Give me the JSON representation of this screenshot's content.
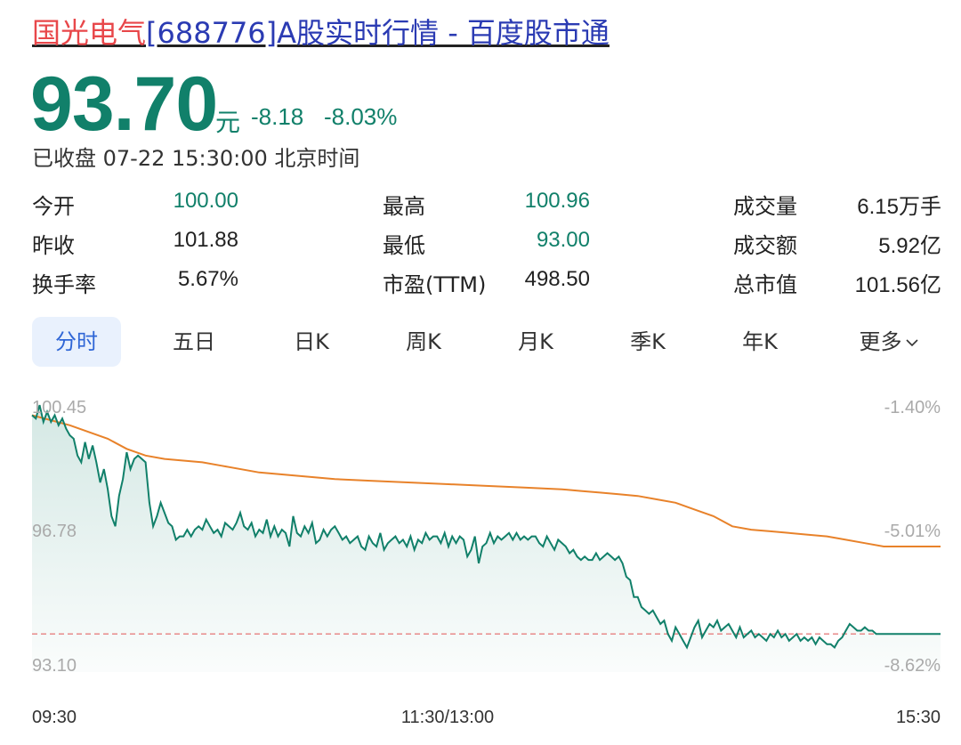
{
  "header": {
    "title_stock": "国光电气",
    "title_rest": "[688776]A股实时行情 - 百度股市通"
  },
  "quote": {
    "price": "93.70",
    "unit": "元",
    "change": "-8.18",
    "change_pct": "-8.03%",
    "status": "已收盘 07-22 15:30:00 北京时间"
  },
  "stats": [
    [
      {
        "label": "今开",
        "value": "100.00",
        "color": "green"
      },
      {
        "label": "最高",
        "value": "100.96",
        "color": "green"
      },
      {
        "label": "成交量",
        "value": "6.15万手",
        "color": "dark"
      }
    ],
    [
      {
        "label": "昨收",
        "value": "101.88",
        "color": "dark"
      },
      {
        "label": "最低",
        "value": "93.00",
        "color": "green"
      },
      {
        "label": "成交额",
        "value": "5.92亿",
        "color": "dark"
      }
    ],
    [
      {
        "label": "换手率",
        "value": "5.67%",
        "color": "dark"
      },
      {
        "label": "市盈(TTM)",
        "value": "498.50",
        "color": "dark"
      },
      {
        "label": "总市值",
        "value": "101.56亿",
        "color": "dark"
      }
    ]
  ],
  "tabs": [
    "分时",
    "五日",
    "日K",
    "周K",
    "月K",
    "季K",
    "年K",
    "更多"
  ],
  "colors": {
    "price_line": "#11806a",
    "avg_line": "#e8822a",
    "ref_line": "#e88a8a",
    "active_tab": "#2f66d6"
  },
  "chart_data": {
    "type": "line",
    "ylim": [
      93.1,
      100.45
    ],
    "y_ticks_left": [
      "100.45",
      "96.78",
      "93.10"
    ],
    "y_ticks_right": [
      "-1.40%",
      "-5.01%",
      "-8.62%"
    ],
    "x_ticks": [
      "09:30",
      "11:30/13:00",
      "15:30"
    ],
    "reference_line": 93.7,
    "series": [
      {
        "role": "price",
        "t": [
          0,
          1,
          2,
          3,
          4,
          5,
          6,
          7,
          8,
          9,
          10,
          11,
          12,
          13,
          14,
          15,
          16,
          17,
          18,
          19,
          20,
          21,
          22,
          23,
          24,
          25,
          26,
          27,
          28,
          29,
          30,
          31,
          32,
          33,
          34,
          35,
          36,
          37,
          38,
          39,
          40,
          41,
          42,
          43,
          44,
          45,
          46,
          47,
          48,
          49,
          50,
          51,
          52,
          53,
          54,
          55,
          56,
          57,
          58,
          59,
          60,
          61,
          62,
          63,
          64,
          65,
          66,
          67,
          68,
          69,
          70,
          71,
          72,
          73,
          74,
          75,
          76,
          77,
          78,
          79,
          80,
          81,
          82,
          83,
          84,
          85,
          86,
          87,
          88,
          89,
          90,
          91,
          92,
          93,
          94,
          95,
          96,
          97,
          98,
          99,
          100,
          101,
          102,
          103,
          104,
          105,
          106,
          107,
          108,
          109,
          110,
          111,
          112,
          113,
          114,
          115,
          116,
          117,
          118,
          119,
          120,
          121,
          122,
          123,
          124,
          125,
          126,
          127,
          128,
          129,
          130,
          131,
          132,
          133,
          134,
          135,
          136,
          137,
          138,
          139,
          140,
          141,
          142,
          143,
          144,
          145,
          146,
          147,
          148,
          149,
          150,
          151,
          152,
          153,
          154,
          155,
          156,
          157,
          158,
          159,
          160,
          161,
          162,
          163,
          164,
          165,
          166,
          167,
          168,
          169,
          170,
          171,
          172,
          173,
          174,
          175,
          176,
          177,
          178,
          179,
          180,
          181,
          182,
          183,
          184,
          185,
          186,
          187,
          188,
          189,
          190,
          191,
          192,
          193,
          194,
          195,
          196,
          197,
          198,
          199,
          200,
          201,
          202,
          203,
          204,
          205,
          206,
          207,
          208,
          209,
          210,
          211,
          212,
          213,
          214,
          215,
          216,
          217,
          218,
          219,
          220,
          221,
          222,
          223,
          224,
          225,
          226,
          227,
          228,
          229,
          230,
          231,
          232,
          233,
          234,
          235,
          236,
          237,
          238,
          239,
          240
        ],
        "values": [
          100.2,
          100.1,
          100.5,
          100.0,
          100.3,
          100.0,
          100.2,
          99.9,
          100.1,
          99.8,
          99.6,
          99.5,
          99.0,
          98.8,
          99.4,
          98.9,
          99.3,
          98.8,
          98.2,
          98.6,
          98.0,
          97.2,
          96.9,
          97.8,
          98.3,
          99.1,
          98.6,
          98.9,
          99.0,
          98.9,
          98.8,
          97.6,
          96.9,
          97.2,
          97.6,
          97.3,
          97.0,
          96.9,
          96.5,
          96.6,
          96.6,
          96.8,
          96.6,
          96.8,
          96.9,
          96.8,
          97.1,
          96.9,
          96.7,
          96.8,
          96.6,
          97.0,
          96.9,
          96.8,
          97.0,
          97.3,
          96.9,
          96.8,
          97.0,
          96.6,
          96.8,
          96.7,
          97.1,
          96.6,
          96.9,
          96.6,
          96.8,
          96.7,
          96.3,
          97.2,
          96.7,
          96.6,
          96.9,
          96.7,
          97.0,
          96.4,
          96.5,
          96.8,
          96.6,
          96.8,
          96.9,
          96.7,
          96.5,
          96.6,
          96.4,
          96.5,
          96.6,
          96.3,
          96.2,
          96.6,
          96.4,
          96.3,
          96.7,
          96.2,
          96.4,
          96.5,
          96.6,
          96.4,
          96.5,
          96.3,
          96.6,
          96.2,
          96.5,
          96.4,
          96.7,
          96.5,
          96.6,
          96.6,
          96.4,
          96.7,
          96.3,
          96.6,
          96.4,
          96.6,
          96.5,
          96.0,
          96.2,
          96.6,
          95.8,
          96.3,
          96.4,
          96.7,
          96.4,
          96.6,
          96.5,
          96.6,
          96.7,
          96.5,
          96.7,
          96.5,
          96.6,
          96.5,
          96.6,
          96.6,
          96.4,
          96.3,
          96.6,
          96.4,
          96.2,
          96.5,
          96.4,
          96.3,
          96.1,
          96.2,
          96.0,
          95.9,
          96.0,
          95.9,
          95.9,
          96.1,
          95.9,
          96.0,
          96.1,
          96.0,
          95.9,
          96.0,
          95.8,
          95.4,
          95.3,
          94.8,
          94.8,
          94.5,
          94.4,
          94.3,
          94.4,
          94.2,
          94.0,
          94.1,
          93.7,
          93.5,
          93.9,
          93.7,
          93.5,
          93.3,
          93.6,
          93.9,
          94.1,
          93.6,
          93.8,
          94.0,
          93.9,
          94.1,
          93.8,
          93.9,
          94.0,
          93.8,
          93.6,
          93.9,
          93.6,
          93.7,
          93.8,
          93.6,
          93.7,
          93.6,
          93.5,
          93.7,
          93.6,
          93.8,
          93.6,
          93.7,
          93.5,
          93.6,
          93.7,
          93.5,
          93.6,
          93.5,
          93.6,
          93.4,
          93.6,
          93.5,
          93.4,
          93.4,
          93.3,
          93.5,
          93.6,
          93.8,
          94.0,
          93.9,
          93.8,
          93.8,
          93.9,
          93.8,
          93.8,
          93.7,
          93.7,
          93.7,
          93.7,
          93.7,
          93.7,
          93.7,
          93.7,
          93.7,
          93.7,
          93.7,
          93.7,
          93.7,
          93.7,
          93.7,
          93.7,
          93.7,
          93.7,
          93.7,
          93.7
        ]
      },
      {
        "role": "average",
        "t": [
          0,
          10,
          20,
          25,
          30,
          35,
          45,
          50,
          60,
          70,
          80,
          90,
          100,
          110,
          120,
          130,
          140,
          145,
          150,
          155,
          160,
          165,
          170,
          175,
          180,
          185,
          190,
          195,
          200,
          205,
          210,
          215,
          220,
          225,
          230,
          235,
          240
        ],
        "values": [
          100.2,
          99.9,
          99.5,
          99.2,
          99.0,
          98.9,
          98.8,
          98.7,
          98.5,
          98.4,
          98.3,
          98.25,
          98.2,
          98.15,
          98.1,
          98.05,
          98.0,
          97.95,
          97.9,
          97.85,
          97.8,
          97.7,
          97.6,
          97.4,
          97.2,
          96.9,
          96.8,
          96.75,
          96.7,
          96.65,
          96.6,
          96.5,
          96.4,
          96.3,
          96.3,
          96.3,
          96.3
        ]
      }
    ]
  }
}
